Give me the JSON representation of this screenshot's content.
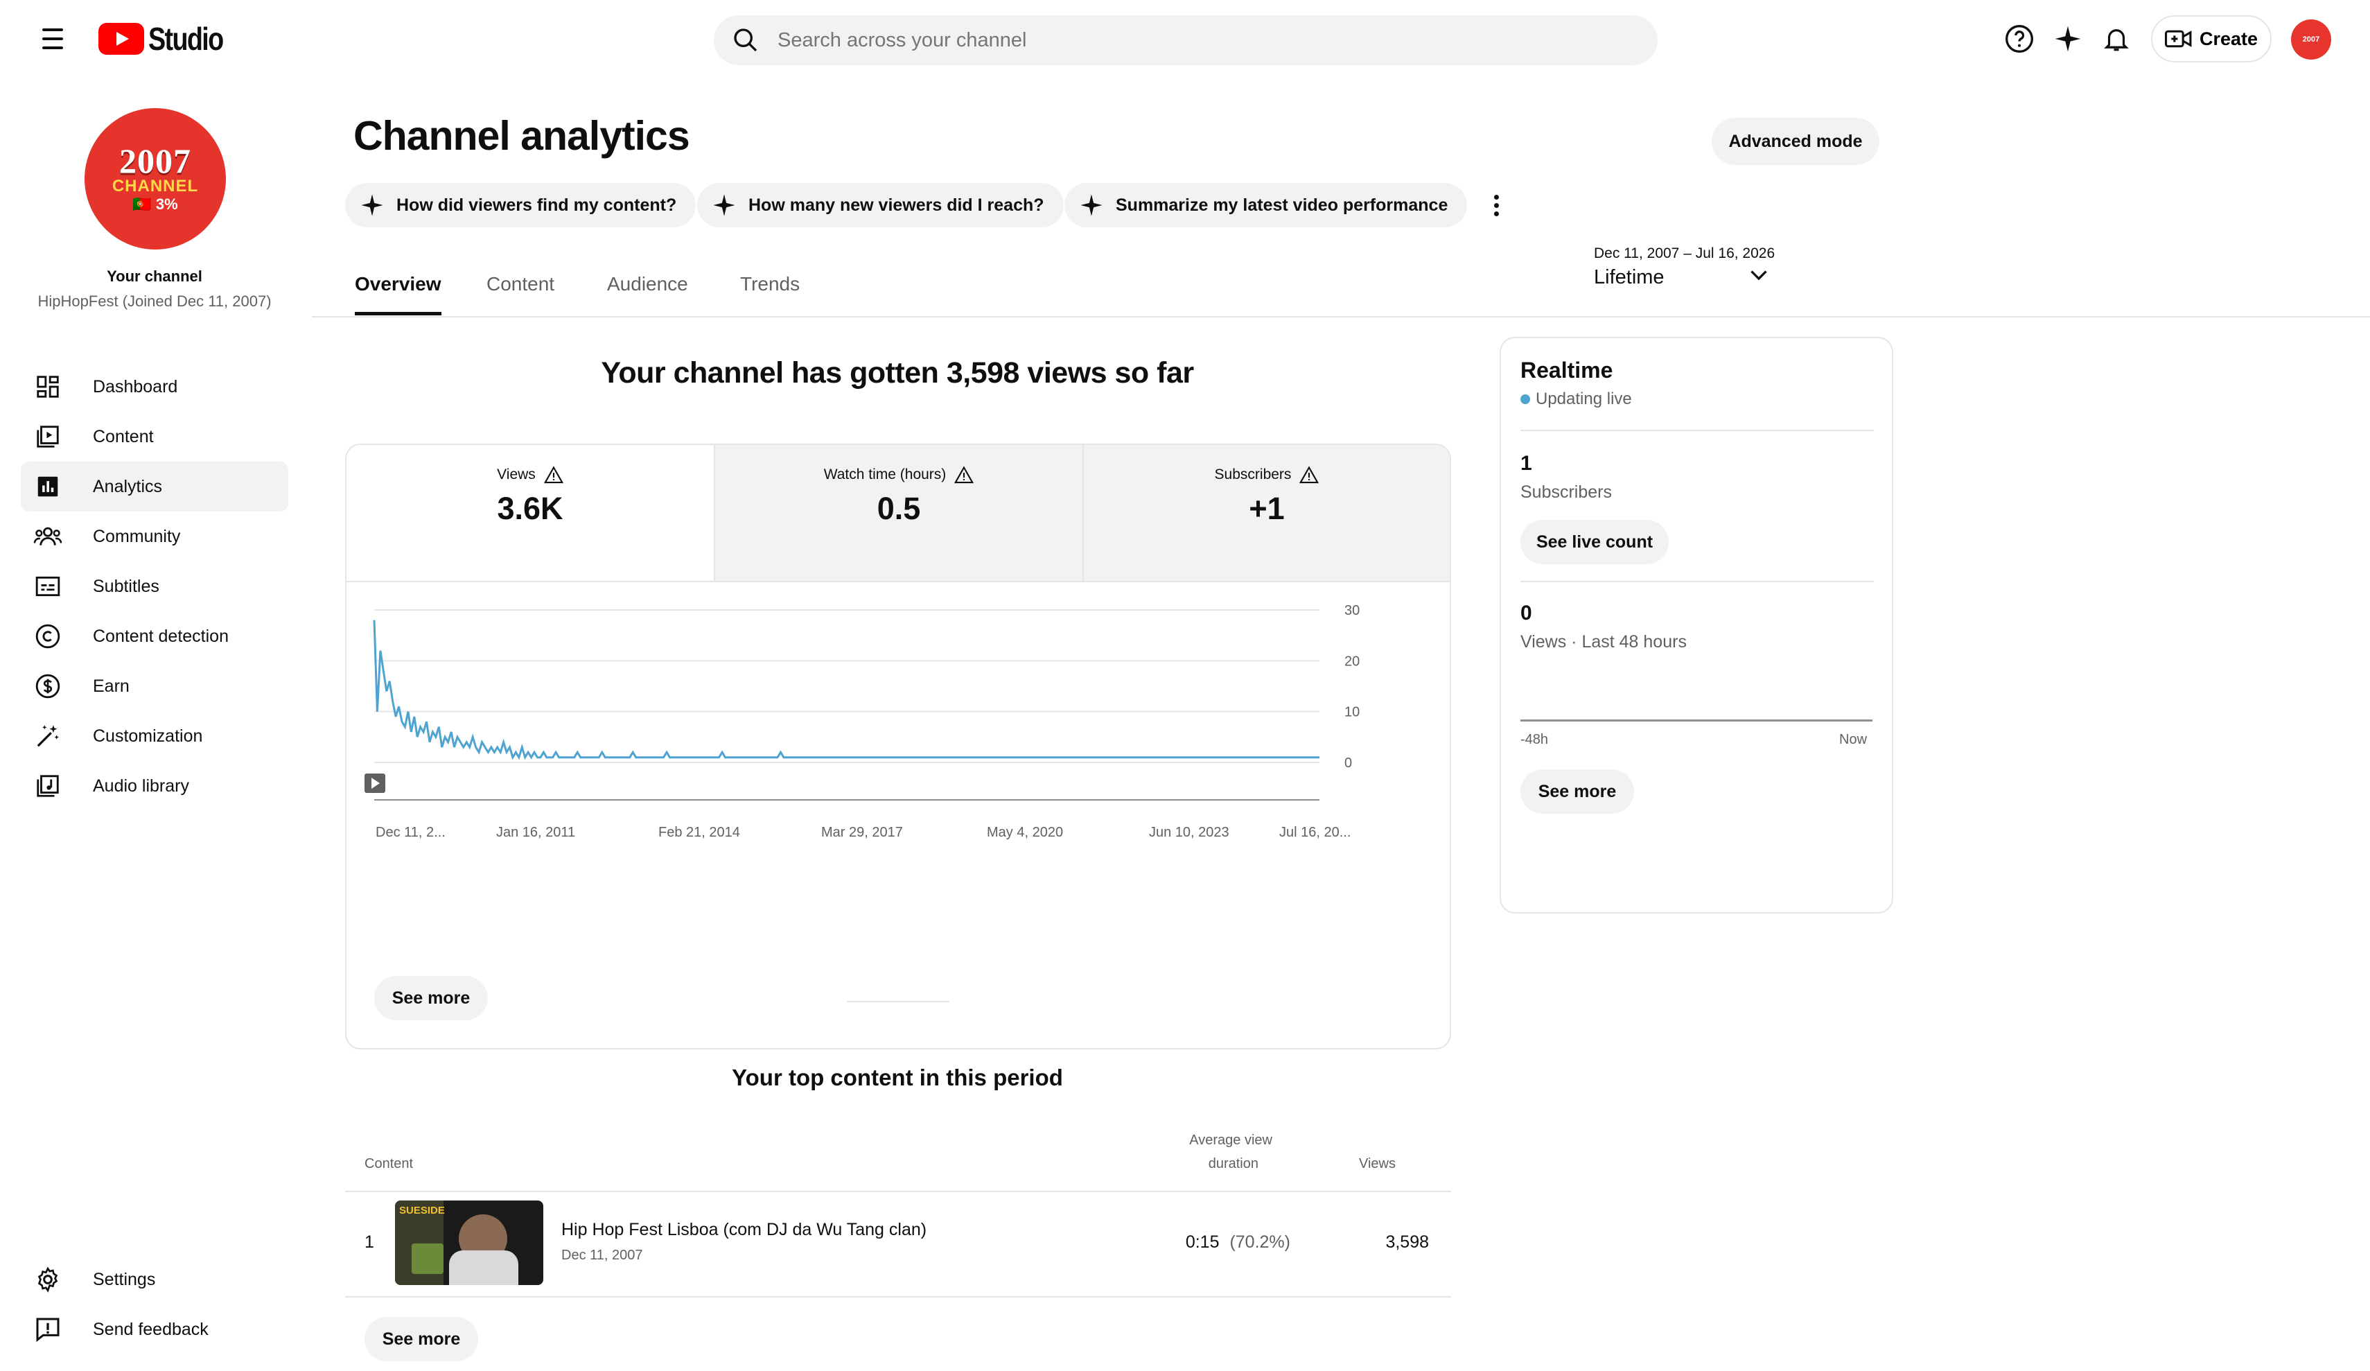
{
  "header": {
    "brand": "Studio",
    "search_placeholder": "Search across your channel",
    "create_label": "Create",
    "avatar_text": "2007"
  },
  "sidebar": {
    "channel_avatar": {
      "year": "2007",
      "word": "CHANNEL",
      "flag_text": "🇵🇹 3%"
    },
    "your_channel": "Your channel",
    "channel_name": "HipHopFest (Joined Dec 11, 2007)",
    "items": [
      {
        "label": "Dashboard",
        "icon": "dashboard-icon"
      },
      {
        "label": "Content",
        "icon": "content-icon"
      },
      {
        "label": "Analytics",
        "icon": "analytics-icon",
        "active": true
      },
      {
        "label": "Community",
        "icon": "community-icon"
      },
      {
        "label": "Subtitles",
        "icon": "subtitles-icon"
      },
      {
        "label": "Content detection",
        "icon": "copyright-icon"
      },
      {
        "label": "Earn",
        "icon": "earn-icon"
      },
      {
        "label": "Customization",
        "icon": "customization-icon"
      },
      {
        "label": "Audio library",
        "icon": "audio-library-icon"
      }
    ],
    "bottom": [
      {
        "label": "Settings",
        "icon": "gear-icon"
      },
      {
        "label": "Send feedback",
        "icon": "feedback-icon"
      }
    ]
  },
  "main": {
    "title": "Channel analytics",
    "advanced_mode": "Advanced mode",
    "chips": [
      "How did viewers find my content?",
      "How many new viewers did I reach?",
      "Summarize my latest video performance"
    ],
    "tabs": [
      "Overview",
      "Content",
      "Audience",
      "Trends"
    ],
    "active_tab": "Overview",
    "date_range": {
      "dates": "Dec 11, 2007 – Jul 16, 2026",
      "label": "Lifetime"
    },
    "headline": "Your channel has gotten 3,598 views so far",
    "kpis": [
      {
        "label": "Views",
        "value": "3.6K"
      },
      {
        "label": "Watch time (hours)",
        "value": "0.5"
      },
      {
        "label": "Subscribers",
        "value": "+1"
      }
    ],
    "see_more": "See more"
  },
  "chart_data": {
    "type": "line",
    "series": [
      {
        "values": [
          28,
          10,
          22,
          18,
          14,
          16,
          12,
          9,
          11,
          8,
          7,
          10,
          6,
          9,
          5,
          7,
          6,
          8,
          4,
          6,
          5,
          7,
          3,
          5,
          4,
          6,
          3,
          5,
          4,
          3,
          4,
          3,
          5,
          3,
          2,
          4,
          3,
          2,
          3,
          2,
          3,
          2,
          4,
          2,
          3,
          1,
          2,
          1,
          3,
          1,
          2,
          1,
          2,
          1,
          1,
          2,
          1,
          1,
          1,
          2,
          1,
          1,
          1,
          1,
          1,
          1,
          2,
          1,
          1,
          1,
          1,
          1,
          1,
          1,
          2,
          1,
          1,
          1,
          1,
          1,
          1,
          1,
          1,
          1,
          2,
          1,
          1,
          1,
          1,
          1,
          1,
          1,
          1,
          1,
          1,
          2,
          1,
          1,
          1,
          1,
          1,
          1,
          1,
          1,
          1,
          1,
          1,
          1,
          1,
          1,
          1,
          1,
          1,
          2,
          1,
          1,
          1,
          1,
          1,
          1,
          1,
          1,
          1,
          1,
          1,
          1,
          1,
          1,
          1,
          1,
          1,
          1,
          2,
          1,
          1,
          1,
          1,
          1,
          1,
          1,
          1,
          1,
          1,
          1,
          1,
          1,
          1,
          1,
          1,
          1,
          1,
          1,
          1,
          1,
          1,
          1,
          1,
          1,
          1,
          1,
          1,
          1,
          1,
          1,
          1,
          1,
          1,
          1,
          1,
          1,
          1,
          1,
          1,
          1,
          1,
          1,
          1,
          1,
          1,
          1,
          1,
          1,
          1,
          1,
          1,
          1,
          1,
          1,
          1,
          1,
          1,
          1,
          1,
          1,
          1,
          1,
          1,
          1,
          1,
          1,
          1,
          1,
          1,
          1,
          1,
          1,
          1,
          1,
          1,
          1,
          1,
          1,
          1,
          1,
          1,
          1,
          1,
          1,
          1,
          1,
          1,
          1,
          1,
          1,
          1,
          1,
          1,
          1,
          1,
          1,
          1,
          1,
          1,
          1,
          1,
          1,
          1,
          1,
          1,
          1,
          1,
          1,
          1,
          1,
          1,
          1,
          1,
          1,
          1,
          1,
          1,
          1,
          1,
          1,
          1,
          1,
          1,
          1,
          1,
          1,
          1,
          1,
          1,
          1,
          1,
          1,
          1,
          1,
          1,
          1,
          1,
          1,
          1,
          1,
          1,
          1,
          1,
          1,
          1,
          1,
          1,
          1,
          1,
          1,
          1,
          1,
          1,
          1,
          1,
          1,
          1,
          1,
          1,
          1,
          1,
          1,
          1,
          1,
          1,
          1,
          1,
          1,
          1,
          1,
          1,
          1,
          1,
          1
        ]
      }
    ],
    "x_ticks": [
      "Dec 11, 2...",
      "Jan 16, 2011",
      "Feb 21, 2014",
      "Mar 29, 2017",
      "May 4, 2020",
      "Jun 10, 2023",
      "Jul 16, 20..."
    ],
    "y_ticks": [
      "30",
      "20",
      "10",
      "0"
    ],
    "ylim": [
      0,
      30
    ],
    "grid": true,
    "color": "#4fa3d1"
  },
  "realtime": {
    "title": "Realtime",
    "status": "Updating live",
    "subscribers_value": "1",
    "subscribers_label": "Subscribers",
    "see_live_count": "See live count",
    "views_value": "0",
    "views_label": "Views · Last 48 hours",
    "axis_start": "-48h",
    "axis_end": "Now",
    "see_more": "See more"
  },
  "top_content": {
    "title": "Your top content in this period",
    "col_content": "Content",
    "col_avd_1": "Average view",
    "col_avd_2": "duration",
    "col_views": "Views",
    "rows": [
      {
        "rank": "1",
        "title": "Hip Hop Fest Lisboa (com DJ da Wu Tang clan)",
        "date": "Dec 11, 2007",
        "avd": "0:15",
        "avd_pct": "(70.2%)",
        "views": "3,598",
        "thumb_text": "SUESIDE"
      }
    ],
    "see_more": "See more"
  }
}
